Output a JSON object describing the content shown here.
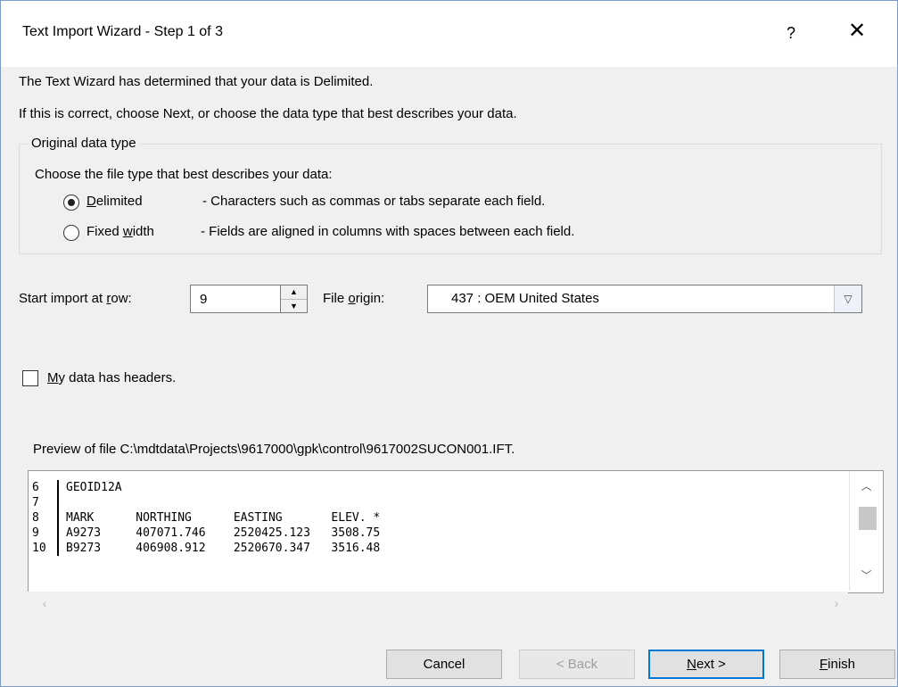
{
  "window": {
    "title": "Text Import Wizard - Step 1 of 3",
    "help_label": "?",
    "close_label": "✕"
  },
  "intro": {
    "line1": "The Text Wizard has determined that your data is Delimited.",
    "line2": "If this is correct, choose Next, or choose the data type that best describes your data."
  },
  "original_data_type": {
    "legend": "Original data type",
    "prompt": "Choose the file type that best describes your data:",
    "options": [
      {
        "label": "Delimited",
        "description": "- Characters such as commas or tabs separate each field.",
        "selected": true
      },
      {
        "label": "Fixed width",
        "description": "- Fields are aligned in columns with spaces between each field.",
        "selected": false
      }
    ]
  },
  "start_row": {
    "label": "Start import at row:",
    "value": "9"
  },
  "file_origin": {
    "label": "File origin:",
    "value": "437 : OEM United States"
  },
  "headers_checkbox": {
    "label": "My data has headers.",
    "checked": false
  },
  "preview": {
    "caption": "Preview of file C:\\mdtdata\\Projects\\9617000\\gpk\\control\\9617002SUCON001.IFT.",
    "lines": [
      {
        "num": "6",
        "text": "GEOID12A"
      },
      {
        "num": "7",
        "text": ""
      },
      {
        "num": "8",
        "text": "MARK      NORTHING      EASTING       ELEV. *"
      },
      {
        "num": "9",
        "text": "A9273     407071.746    2520425.123   3508.75"
      },
      {
        "num": "10",
        "text": "B9273     406908.912    2520670.347   3516.48"
      }
    ]
  },
  "buttons": {
    "cancel": "Cancel",
    "back": "< Back",
    "next": "Next >",
    "finish": "Finish"
  }
}
